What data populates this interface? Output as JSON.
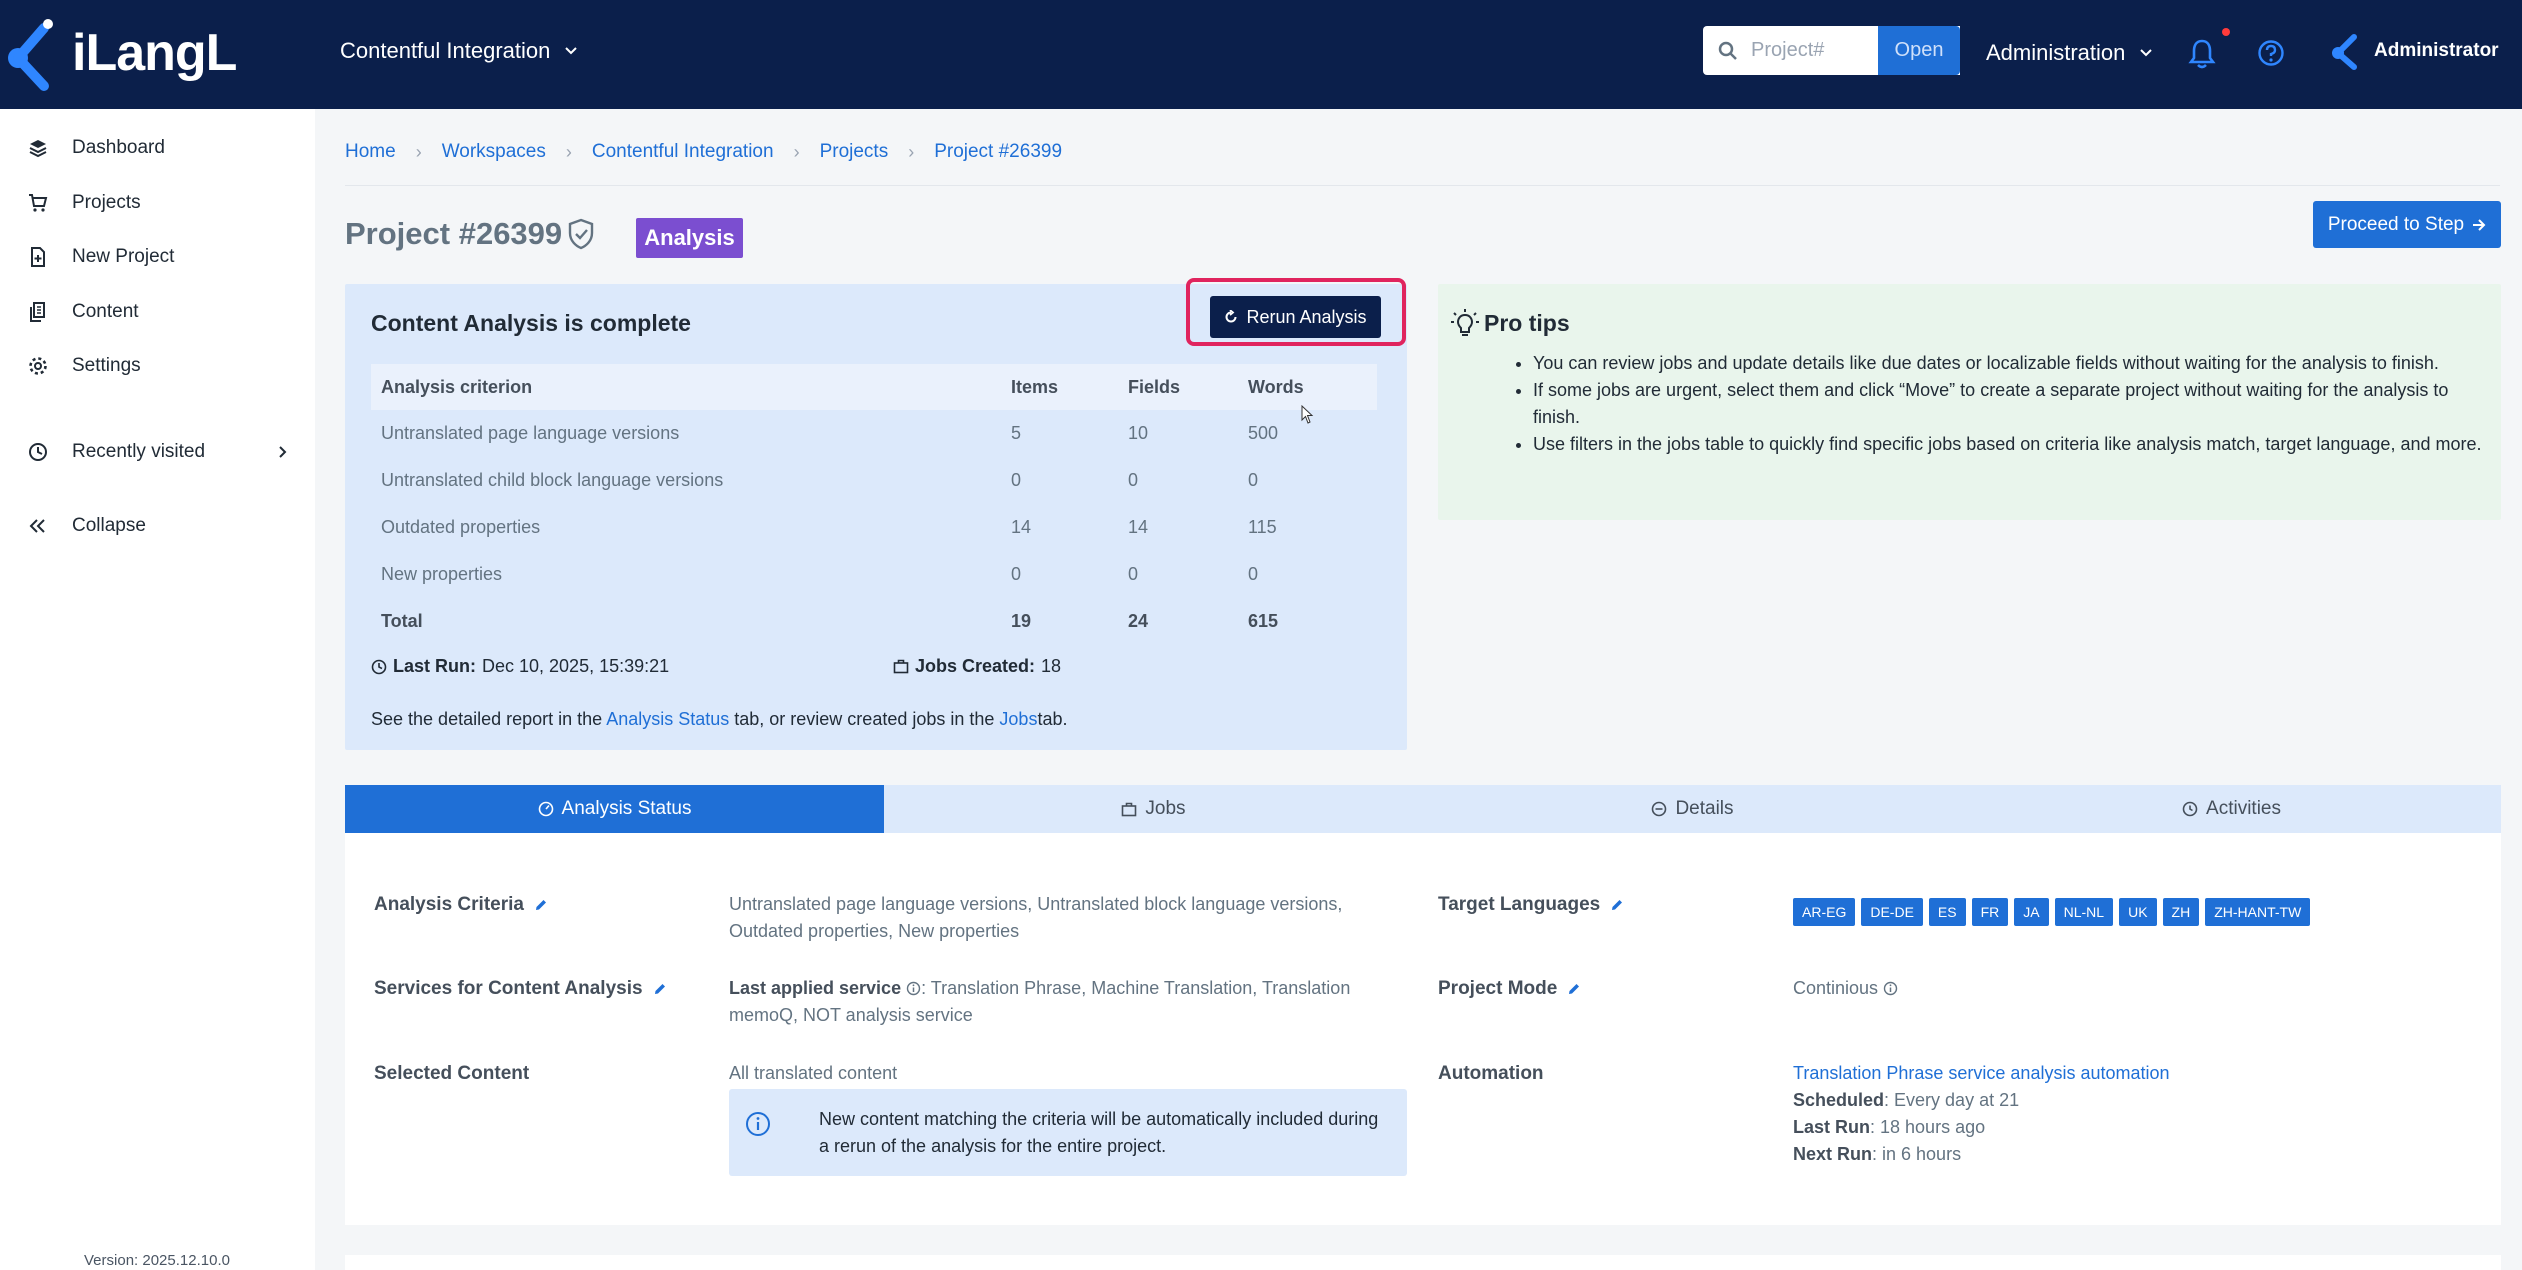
{
  "app": {
    "brand": "iLangL",
    "version": "Version: 2025.12.10.0"
  },
  "topbar": {
    "workspace": "Contentful Integration",
    "search_placeholder": "Project#",
    "open_label": "Open",
    "admin_menu": "Administration",
    "user_name": "Administrator"
  },
  "sidebar": {
    "items": [
      {
        "label": "Dashboard",
        "icon": "layers-icon"
      },
      {
        "label": "Projects",
        "icon": "cart-icon"
      },
      {
        "label": "New Project",
        "icon": "file-plus-icon"
      },
      {
        "label": "Content",
        "icon": "files-icon"
      },
      {
        "label": "Settings",
        "icon": "gear-icon"
      }
    ],
    "recent": "Recently visited",
    "collapse": "Collapse"
  },
  "breadcrumb": [
    "Home",
    "Workspaces",
    "Contentful Integration",
    "Projects",
    "Project #26399"
  ],
  "page": {
    "title": "Project #26399",
    "status_badge": "Analysis",
    "proceed_label": "Proceed to Step"
  },
  "analysis": {
    "title": "Content Analysis is complete",
    "rerun_label": "Rerun Analysis",
    "headers": [
      "Analysis criterion",
      "Items",
      "Fields",
      "Words"
    ],
    "rows": [
      [
        "Untranslated page language versions",
        "5",
        "10",
        "500"
      ],
      [
        "Untranslated child block language versions",
        "0",
        "0",
        "0"
      ],
      [
        "Outdated properties",
        "14",
        "14",
        "115"
      ],
      [
        "New properties",
        "0",
        "0",
        "0"
      ]
    ],
    "total": [
      "Total",
      "19",
      "24",
      "615"
    ],
    "last_run_label": "Last Run:",
    "last_run_value": "Dec 10, 2025, 15:39:21",
    "jobs_created_label": "Jobs Created:",
    "jobs_created_value": "18",
    "foot_pre": "See the detailed report in the",
    "foot_link1": "Analysis Status",
    "foot_mid": "tab, or review created jobs in the",
    "foot_link2": "Jobs",
    "foot_post": "tab."
  },
  "tips": {
    "title": "Pro tips",
    "items": [
      "You can review jobs and update details like due dates or localizable fields without waiting for the analysis to finish.",
      "If some jobs are urgent, select them and click “Move” to create a separate project without waiting for the analysis to finish.",
      "Use filters in the jobs table to quickly find specific jobs based on criteria like analysis match, target language, and more."
    ]
  },
  "tabs": [
    "Analysis Status",
    "Jobs",
    "Details",
    "Activities"
  ],
  "details": {
    "criteria_label": "Analysis Criteria",
    "criteria_value": "Untranslated page language versions, Untranslated block language versions, Outdated properties, New properties",
    "services_label": "Services for Content Analysis",
    "last_applied_label": "Last applied service",
    "services_value": ": Translation Phrase, Machine Translation, Translation memoQ, NOT analysis service",
    "selected_label": "Selected Content",
    "selected_value": "All translated content",
    "info_text": "New content matching the criteria will be automatically included during a rerun of the analysis for the entire project.",
    "target_label": "Target Languages",
    "languages": [
      "AR-EG",
      "DE-DE",
      "ES",
      "FR",
      "JA",
      "NL-NL",
      "UK",
      "ZH",
      "ZH-HANT-TW"
    ],
    "mode_label": "Project Mode",
    "mode_value": "Continious",
    "automation_label": "Automation",
    "automation_link": "Translation Phrase service analysis automation",
    "scheduled_label": "Scheduled",
    "scheduled_value": ": Every day at 21",
    "last_run_label": "Last Run",
    "last_run_value": ": 18 hours ago",
    "next_run_label": "Next Run",
    "next_run_value": ": in 6 hours"
  },
  "colors": {
    "navy": "#0b1f4b",
    "accent": "#1f6fd6",
    "badge_purple": "#7b4ed0",
    "highlight": "#e0245e"
  }
}
